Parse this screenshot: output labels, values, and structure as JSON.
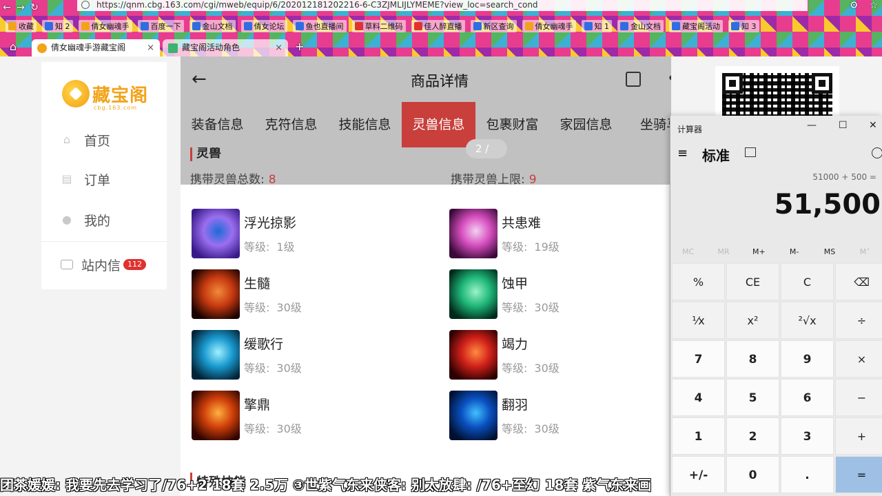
{
  "browser": {
    "url": "https://qnm.cbg.163.com/cgi/mweb/equip/6/202012181202216-6-C3ZJMLIJLYMEME?view_loc=search_cond",
    "bookmarks": [
      {
        "label": "收藏",
        "color": "#f2a31a"
      },
      {
        "label": "知 2",
        "color": "#2f6de1"
      },
      {
        "label": "倩女幽魂手",
        "color": "#f2a31a"
      },
      {
        "label": "百度一下",
        "color": "#2f6de1"
      },
      {
        "label": "金山文档",
        "color": "#2f6de1"
      },
      {
        "label": "倩女论坛",
        "color": "#2f6de1"
      },
      {
        "label": "鱼也直播间",
        "color": "#2f6de1"
      },
      {
        "label": "草料二维码",
        "color": "#e0322f"
      },
      {
        "label": "佳人醉直播",
        "color": "#e0322f"
      },
      {
        "label": "新区查询",
        "color": "#2f6de1"
      },
      {
        "label": "倩女幽魂手",
        "color": "#f2a31a"
      },
      {
        "label": "知 1",
        "color": "#2f6de1"
      },
      {
        "label": "金山文档",
        "color": "#2f6de1"
      },
      {
        "label": "藏宝阁活动",
        "color": "#2f6de1"
      },
      {
        "label": "知 3",
        "color": "#2f6de1"
      }
    ],
    "tabs": [
      {
        "label": "倩女幽魂手游藏宝阁",
        "active": true,
        "fav_color": "#f2a31a"
      },
      {
        "label": "藏宝阁活动角色",
        "active": false,
        "fav_color": "#3cb371"
      }
    ]
  },
  "sidebar": {
    "logo_name": "藏宝阁",
    "logo_domain": "cbg.163.com",
    "items": [
      {
        "label": "首页",
        "icon": "home-icon",
        "glyph": "⌂"
      },
      {
        "label": "订单",
        "icon": "order-icon",
        "glyph": "▤"
      },
      {
        "label": "我的",
        "icon": "user-icon",
        "glyph": "●"
      }
    ],
    "inbox_label": "站内信",
    "inbox_badge": "112"
  },
  "product": {
    "title": "商品详情",
    "tabs": [
      "装备信息",
      "克符信息",
      "技能信息",
      "灵兽信息",
      "包裹财富",
      "家园信息",
      "坐骑马"
    ],
    "active_tab_index": 3,
    "section_title": "灵兽",
    "carry_label": "携带灵兽总数:",
    "carry_value": "8",
    "limit_label": "携带灵兽上限:",
    "limit_value": "9",
    "page_indicator": "2 /",
    "level_label": "等级:",
    "pets": [
      {
        "name": "浮光掠影",
        "level": "1级",
        "colors": [
          "#3a1a8a",
          "#9a6ff0",
          "#1b6cd8"
        ]
      },
      {
        "name": "共患难",
        "level": "19级",
        "colors": [
          "#3b0a3a",
          "#d84fc0",
          "#f2d0f0"
        ]
      },
      {
        "name": "生髓",
        "level": "30级",
        "colors": [
          "#1a0200",
          "#c83a10",
          "#f08a3a"
        ]
      },
      {
        "name": "蚀甲",
        "level": "30级",
        "colors": [
          "#002a1a",
          "#1fb87a",
          "#9cf2c8"
        ]
      },
      {
        "name": "缓歌行",
        "level": "30级",
        "colors": [
          "#022438",
          "#1a9ad0",
          "#9ff0ff"
        ]
      },
      {
        "name": "竭力",
        "level": "30级",
        "colors": [
          "#2a0000",
          "#d0201a",
          "#ff8a40"
        ]
      },
      {
        "name": "擎鼎",
        "level": "30级",
        "colors": [
          "#300400",
          "#d0400a",
          "#ffb040"
        ]
      },
      {
        "name": "翻羽",
        "level": "30级",
        "colors": [
          "#001030",
          "#0a50c0",
          "#40c0ff"
        ]
      }
    ],
    "bottom_section": "特殊技能"
  },
  "calculator": {
    "window_title": "计算器",
    "mode": "标准",
    "expression": "51000 + 500 =",
    "display": "51,500",
    "memory": [
      "MC",
      "MR",
      "M+",
      "M-",
      "MS",
      "M˅"
    ],
    "keys": [
      [
        "%",
        "CE",
        "C",
        "⌫"
      ],
      [
        "¹⁄x",
        "x²",
        "²√x",
        "÷"
      ],
      [
        "7",
        "8",
        "9",
        "×"
      ],
      [
        "4",
        "5",
        "6",
        "−"
      ],
      [
        "1",
        "2",
        "3",
        "+"
      ],
      [
        "+/-",
        "0",
        ".",
        "="
      ]
    ]
  },
  "danmaku": "团茶媛媛: 我要先去学习了/76+2 18套 2.5万 ③世紫气东来侠客: 别太放肆: /76+至幻 18套 紫气东来画"
}
